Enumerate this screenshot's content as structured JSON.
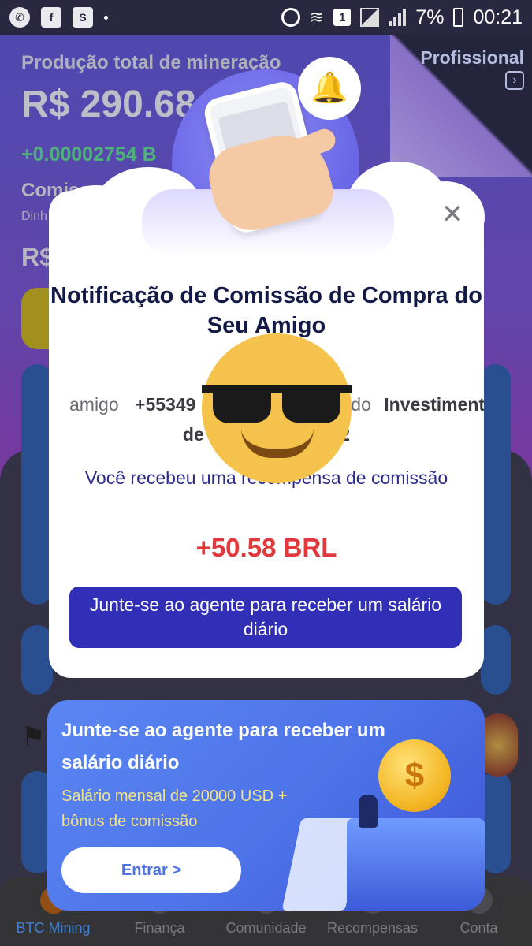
{
  "statusbar": {
    "battery": "7%",
    "time": "00:21",
    "notif_count": "1",
    "icons": [
      "whatsapp-icon",
      "facebook-icon",
      "app-icon",
      "alarm-icon",
      "wifi-icon",
      "signal-icon",
      "battery-icon"
    ]
  },
  "background": {
    "pro_label": "Profissional",
    "production_title": "Produção total de mineração",
    "production_amount": "R$ 290.68",
    "production_delta": "+0.00002754 B",
    "commission_title": "Comiss",
    "commission_sub": "Dinh",
    "commission_amount": "R$"
  },
  "modal": {
    "title": "Notificação de Comissão de Compra do Seu Amigo",
    "friend_prefix": "amigo",
    "friend_phone": "+55349",
    "friend_middle": "rado",
    "friend_product": "Investiment",
    "product_line": "de c                        2",
    "reward_text": "Você recebeu uma recompensa de comissão",
    "amount": "+50.58",
    "currency": "BRL",
    "join_button": "Junte-se ao agente para receber um salário diário",
    "close_icon": "close-icon"
  },
  "banner": {
    "title": "Junte-se ao agente para receber um salário diário",
    "subtitle": "Salário mensal de 20000 USD + bônus de comissão",
    "enter_button": "Entrar >"
  },
  "bottom_nav": [
    {
      "label": "BTC Mining",
      "active": true
    },
    {
      "label": "Finança",
      "active": false
    },
    {
      "label": "Comunidade",
      "active": false
    },
    {
      "label": "Recompensas",
      "active": false
    },
    {
      "label": "Conta",
      "active": false
    }
  ],
  "colors": {
    "accent": "#312fb5",
    "amount_red": "#e2383b",
    "title_navy": "#141a47",
    "banner_blue": "#4d73e8",
    "banner_yellow_text": "#f2e38a"
  }
}
